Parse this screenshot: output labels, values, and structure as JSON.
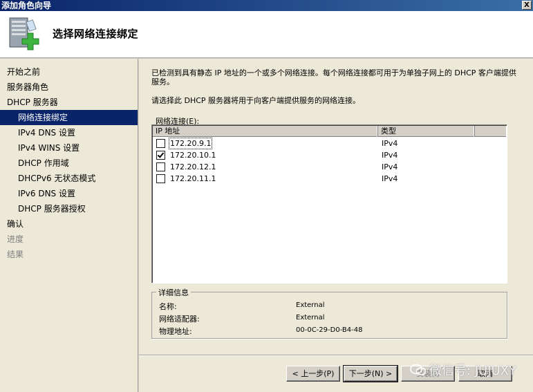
{
  "window": {
    "title": "添加角色向导",
    "close_label": "X"
  },
  "header": {
    "title": "选择网络连接绑定"
  },
  "sidebar": {
    "items": [
      {
        "label": "开始之前",
        "level": 0,
        "state": "normal"
      },
      {
        "label": "服务器角色",
        "level": 0,
        "state": "normal"
      },
      {
        "label": "DHCP 服务器",
        "level": 0,
        "state": "normal"
      },
      {
        "label": "网络连接绑定",
        "level": 1,
        "state": "active"
      },
      {
        "label": "IPv4 DNS 设置",
        "level": 1,
        "state": "normal"
      },
      {
        "label": "IPv4 WINS 设置",
        "level": 1,
        "state": "normal"
      },
      {
        "label": "DHCP 作用域",
        "level": 1,
        "state": "normal"
      },
      {
        "label": "DHCPv6 无状态模式",
        "level": 1,
        "state": "normal"
      },
      {
        "label": "IPv6 DNS 设置",
        "level": 1,
        "state": "normal"
      },
      {
        "label": "DHCP 服务器授权",
        "level": 1,
        "state": "normal"
      },
      {
        "label": "确认",
        "level": 0,
        "state": "normal"
      },
      {
        "label": "进度",
        "level": 0,
        "state": "dim"
      },
      {
        "label": "结果",
        "level": 0,
        "state": "dim"
      }
    ]
  },
  "main": {
    "intro": "已检测到具有静态 IP 地址的一个或多个网络连接。每个网络连接都可用于为单独子网上的 DHCP 客户端提供服务。",
    "instruction": "请选择此 DHCP 服务器将用于向客户端提供服务的网络连接。",
    "list_label": "网络连接(E):",
    "columns": {
      "ip": "IP 地址",
      "type": "类型"
    },
    "rows": [
      {
        "ip": "172.20.9.1",
        "type": "IPv4",
        "checked": false,
        "focused": true
      },
      {
        "ip": "172.20.10.1",
        "type": "IPv4",
        "checked": true,
        "focused": false
      },
      {
        "ip": "172.20.12.1",
        "type": "IPv4",
        "checked": false,
        "focused": false
      },
      {
        "ip": "172.20.11.1",
        "type": "IPv4",
        "checked": false,
        "focused": false
      }
    ],
    "details": {
      "legend": "详细信息",
      "name_label": "名称:",
      "name_value": "External",
      "adapter_label": "网络适配器:",
      "adapter_value": "External",
      "mac_label": "物理地址:",
      "mac_value": "00-0C-29-D0-B4-48"
    }
  },
  "buttons": {
    "prev": "< 上一步(P)",
    "next": "下一步(N) >",
    "install": "安装(I)",
    "cancel": "取消"
  },
  "watermark": {
    "text": "微信号: JUJUXY"
  },
  "colors": {
    "active_bg": "#0a246a",
    "titlebar": "#0a246a",
    "dim_text": "#808080"
  }
}
